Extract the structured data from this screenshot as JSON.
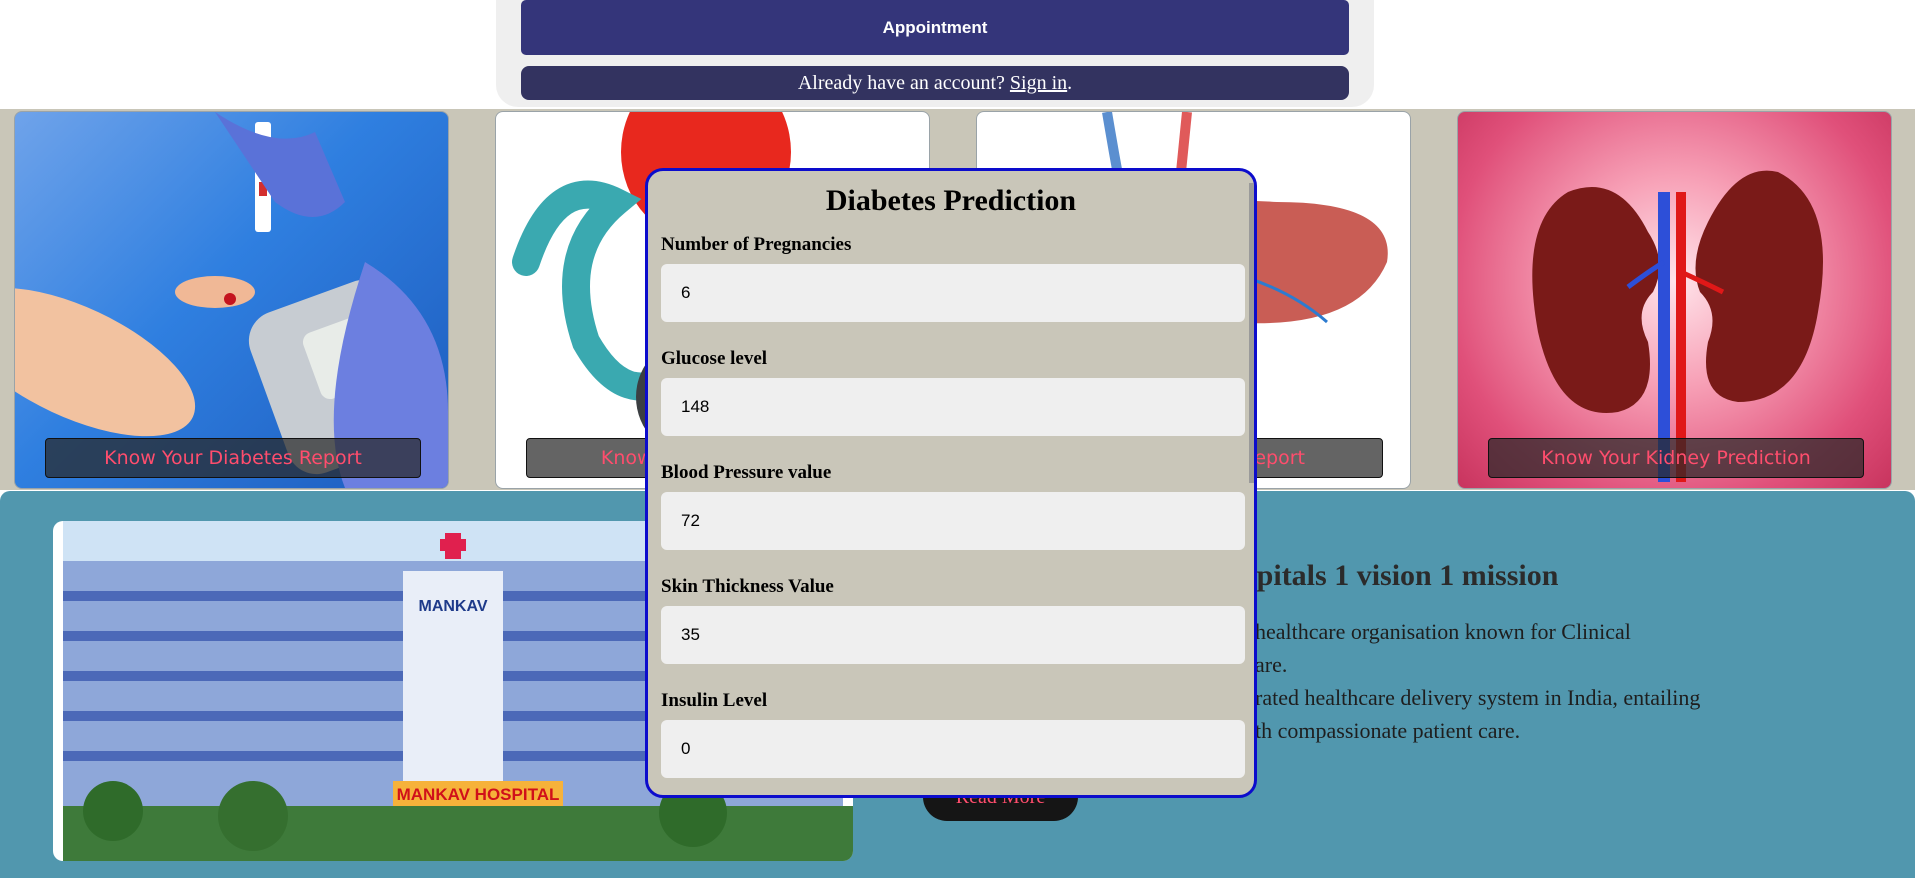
{
  "top_panel": {
    "appointment_label": "Appointment",
    "signin_prompt": "Already have an account? ",
    "signin_link": "Sign in",
    "signin_suffix": "."
  },
  "cards": [
    {
      "label": "Know Your Diabetes Report"
    },
    {
      "label": "Know Your Heart Report"
    },
    {
      "label": "Know Your Liver Report"
    },
    {
      "label": "Know Your Kidney Prediction"
    }
  ],
  "hero": {
    "hospital_sign": "MANKAV HOSPITAL",
    "hospital_name_top": "MANKAV",
    "title": "spitals 1 vision 1 mission",
    "lines": [
      "healthcare organisation known for Clinical",
      "are.",
      "rated healthcare delivery system in India, entailing",
      "th compassionate patient care."
    ],
    "read_more": "Read More"
  },
  "modal": {
    "title": "Diabetes Prediction",
    "fields": [
      {
        "label": "Number of Pregnancies",
        "value": "6"
      },
      {
        "label": "Glucose level",
        "value": "148"
      },
      {
        "label": "Blood Pressure value",
        "value": "72"
      },
      {
        "label": "Skin Thickness Value",
        "value": "35"
      },
      {
        "label": "Insulin Level",
        "value": "0"
      }
    ]
  },
  "colors": {
    "primary_button": "#34357a",
    "card_button_text": "#ff4d6d",
    "hero_bg": "#5197ae",
    "modal_border": "#0c0ccc",
    "modal_bg": "#c9c6b9"
  }
}
